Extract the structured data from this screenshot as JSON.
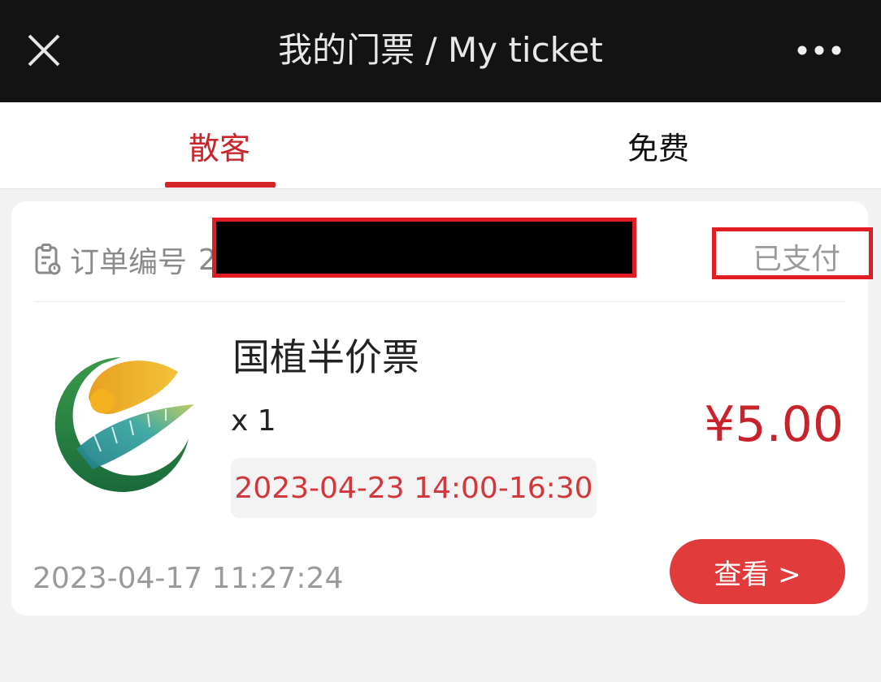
{
  "header": {
    "title": "我的门票 / My ticket"
  },
  "tabs": [
    {
      "label": "散客",
      "active": true
    },
    {
      "label": "免费",
      "active": false
    }
  ],
  "order": {
    "number_label": "订单编号",
    "number_visible_prefix": "2",
    "status": "已支付",
    "ticket_name": "国植半价票",
    "quantity": "x 1",
    "price": "¥5.00",
    "time_slot": "2023-04-23 14:00-16:30",
    "order_time": "2023-04-17 11:27:24",
    "view_button": "查看 >"
  },
  "colors": {
    "accent": "#d3242a",
    "price": "#c8222a",
    "button": "#e13b3b",
    "topbar": "#131313"
  }
}
